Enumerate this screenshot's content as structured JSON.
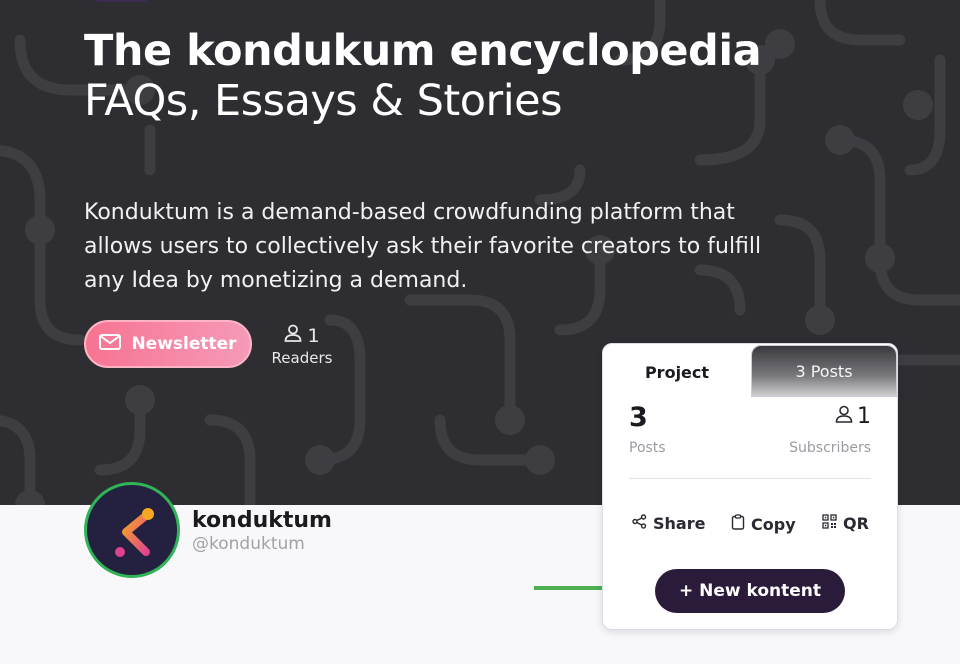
{
  "hero": {
    "title_bold": "The kondukum encyclopedia",
    "title_light": " FAQs, Essays & Stories",
    "description": "Konduktum is a demand-based crowdfunding platform that allows users to collectively ask their favorite creators to fulfill any Idea by monetizing a demand.",
    "newsletter_label": "Newsletter",
    "readers_count": "1",
    "readers_label": "Readers"
  },
  "profile": {
    "name": "konduktum",
    "handle": "@konduktum"
  },
  "card": {
    "tabs": [
      {
        "label": "Project",
        "active": true
      },
      {
        "label": "3 Posts",
        "active": false
      }
    ],
    "posts_value": "3",
    "posts_label": "Posts",
    "subscribers_value": "1",
    "subscribers_label": "Subscribers",
    "actions": {
      "share": "Share",
      "copy": "Copy",
      "qr": "QR"
    },
    "new_kontent_label": "+ New kontent"
  },
  "colors": {
    "hero_bg": "#2e2d31",
    "newsletter_start": "#f77492",
    "newsletter_end": "#f59ab8",
    "primary_button": "#2b1b3b",
    "avatar_ring": "#2fb457",
    "arrow": "#4caf50"
  },
  "icons": {
    "newsletter": "mail-icon",
    "readers": "user-icon",
    "subscribers": "user-icon",
    "share": "share-icon",
    "copy": "clipboard-icon",
    "qr": "qr-code-icon"
  }
}
